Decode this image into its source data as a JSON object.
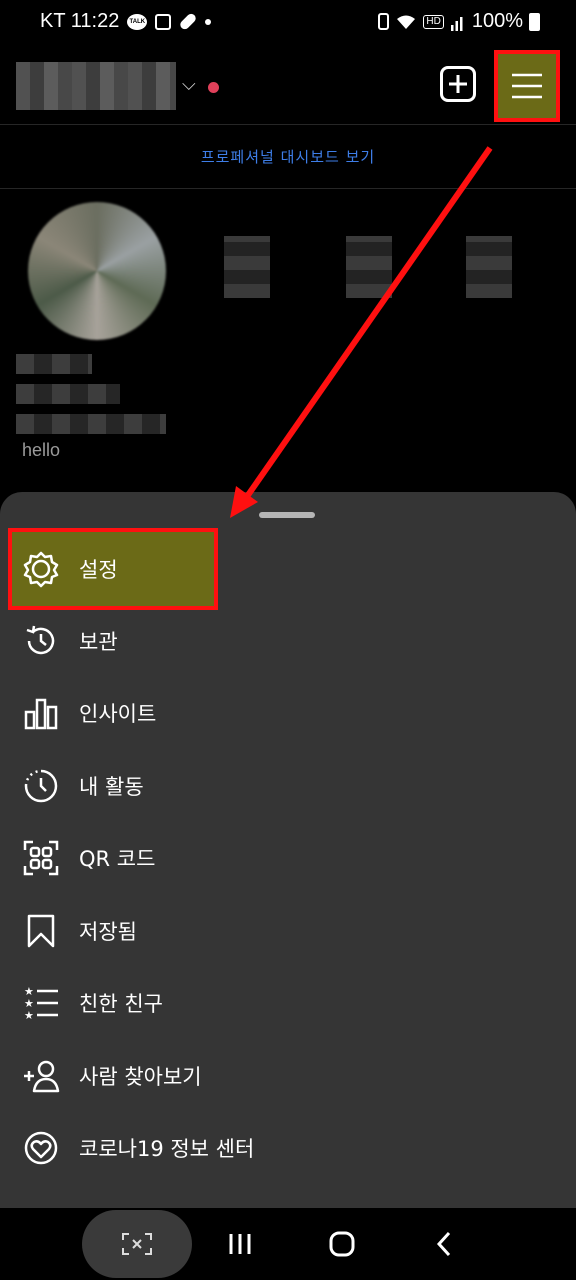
{
  "status_bar": {
    "carrier_time": "KT 11:22",
    "left_icons": [
      "kakaotalk-icon",
      "gallery-icon",
      "pill-icon",
      "dot-icon"
    ],
    "kakaotalk_label": "TALK",
    "right_icons": [
      "nfc-icon",
      "wifi-icon",
      "hd-icon",
      "signal-icon",
      "battery-icon"
    ],
    "hd_label": "HD",
    "battery": "100%"
  },
  "profile": {
    "pro_dashboard_link": "프로페셔널 대시보드 보기",
    "bio_fragment": "hello"
  },
  "menu": {
    "items": [
      {
        "label": "설정",
        "icon": "settings-icon"
      },
      {
        "label": "보관",
        "icon": "archive-icon"
      },
      {
        "label": "인사이트",
        "icon": "insights-icon"
      },
      {
        "label": "내 활동",
        "icon": "activity-icon"
      },
      {
        "label": "QR 코드",
        "icon": "qr-code-icon"
      },
      {
        "label": "저장됨",
        "icon": "bookmark-icon"
      },
      {
        "label": "친한 친구",
        "icon": "close-friends-icon"
      },
      {
        "label": "사람 찾아보기",
        "icon": "discover-people-icon"
      },
      {
        "label": "코로나19 정보 센터",
        "icon": "covid-info-icon"
      }
    ]
  },
  "colors": {
    "highlight": "#6b6a17",
    "annotation_red": "#ff1010",
    "link_blue": "#3e7ee8",
    "sheet_bg": "#353535"
  },
  "nav_bar": {
    "icons": [
      "screen-capture-icon",
      "recents-icon",
      "home-icon",
      "back-icon"
    ]
  }
}
